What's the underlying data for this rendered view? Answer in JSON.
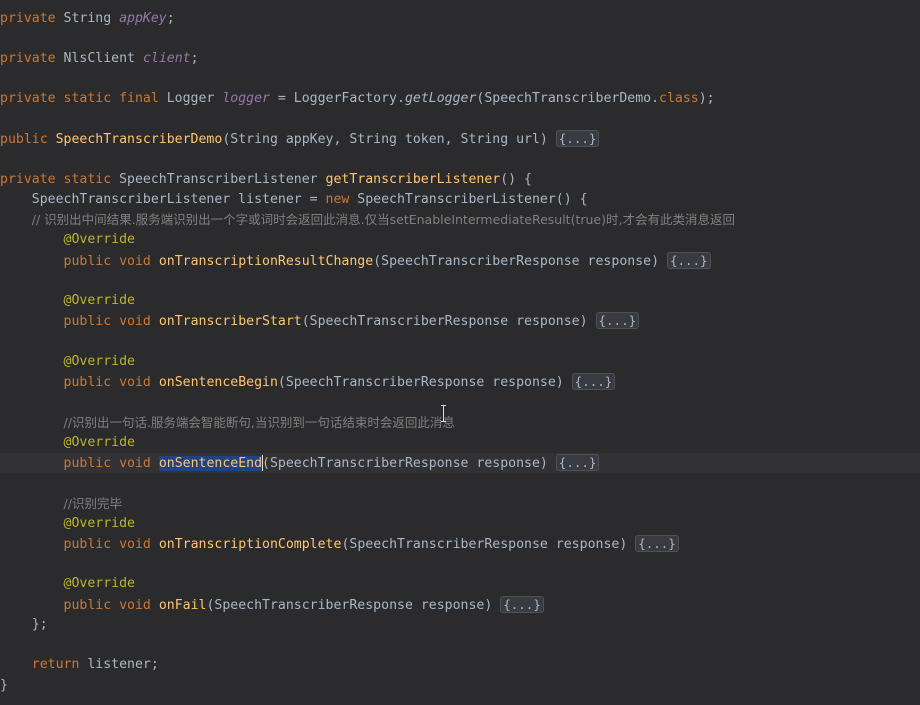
{
  "colors": {
    "background": "#2b2b2d",
    "current_line": "#323235",
    "keyword": "#cc7832",
    "method": "#ffc66d",
    "field": "#9876aa",
    "annotation": "#bbb529",
    "comment": "#808080",
    "selection": "#214283"
  },
  "code": {
    "l1": [
      "private ",
      "String ",
      "appKey",
      ";"
    ],
    "l2": [
      "private ",
      "NlsClient ",
      "client",
      ";"
    ],
    "l3": [
      "private static final ",
      "Logger ",
      "logger",
      " = LoggerFactory.",
      "getLogger",
      "(SpeechTranscriberDemo.",
      "class",
      ");"
    ],
    "l4": [
      "public ",
      "SpeechTranscriberDemo",
      "(String appKey, String token, String url) ",
      "{...}"
    ],
    "l5": [
      "private static ",
      "SpeechTranscriberListener ",
      "getTranscriberListener",
      "() {"
    ],
    "l6": [
      "    SpeechTranscriberListener listener = ",
      "new ",
      "SpeechTranscriberListener() {"
    ],
    "l7": [
      "        // 识别出中间结果.服务端识别出一个字或词时会返回此消息.仅当setEnableIntermediateResult(true)时,才会有此类消息返回"
    ],
    "l8": [
      "        ",
      "@Override"
    ],
    "l9": [
      "        ",
      "public void ",
      "onTranscriptionResultChange",
      "(SpeechTranscriberResponse response) ",
      "{...}"
    ],
    "l10": [
      "        ",
      "@Override"
    ],
    "l11": [
      "        ",
      "public void ",
      "onTranscriberStart",
      "(SpeechTranscriberResponse response) ",
      "{...}"
    ],
    "l12": [
      "        ",
      "@Override"
    ],
    "l13": [
      "        ",
      "public void ",
      "onSentenceBegin",
      "(SpeechTranscriberResponse response) ",
      "{...}"
    ],
    "l14": [
      "        ",
      "//识别出一句话.服务端会智能断句,当识别到一句话结束时会返回此消息"
    ],
    "l15": [
      "        ",
      "@Override"
    ],
    "l16": [
      "        ",
      "public void ",
      "onSentenceEnd",
      "(SpeechTranscriberResponse response) ",
      "{...}"
    ],
    "l17": [
      "        ",
      "//识别完毕"
    ],
    "l18": [
      "        ",
      "@Override"
    ],
    "l19": [
      "        ",
      "public void ",
      "onTranscriptionComplete",
      "(SpeechTranscriberResponse response) ",
      "{...}"
    ],
    "l20": [
      "        ",
      "@Override"
    ],
    "l21": [
      "        ",
      "public void ",
      "onFail",
      "(SpeechTranscriberResponse response) ",
      "{...}"
    ],
    "l22": [
      "    };"
    ],
    "l23": [
      "    ",
      "return ",
      "listener;"
    ],
    "l24": [
      "}"
    ]
  }
}
